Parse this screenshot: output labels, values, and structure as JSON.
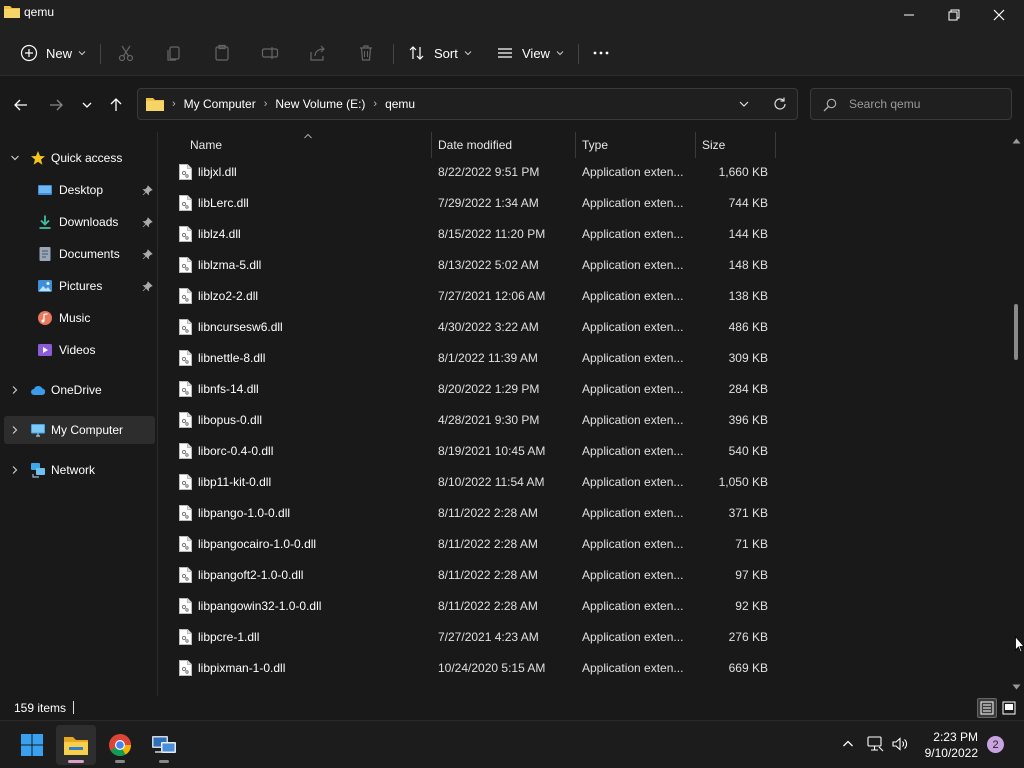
{
  "window": {
    "title": "qemu"
  },
  "toolbar": {
    "new_label": "New",
    "sort_label": "Sort",
    "view_label": "View"
  },
  "address": {
    "crumbs": [
      "My Computer",
      "New Volume (E:)",
      "qemu"
    ],
    "search_placeholder": "Search qemu"
  },
  "sidebar": {
    "quick_access": "Quick access",
    "pinned": [
      "Desktop",
      "Downloads",
      "Documents",
      "Pictures"
    ],
    "music": "Music",
    "videos": "Videos",
    "onedrive": "OneDrive",
    "my_computer": "My Computer",
    "network": "Network"
  },
  "columns": {
    "name": "Name",
    "date": "Date modified",
    "type": "Type",
    "size": "Size"
  },
  "files": [
    {
      "name": "libjxl.dll",
      "date": "8/22/2022 9:51 PM",
      "type": "Application exten...",
      "size": "1,660 KB"
    },
    {
      "name": "libLerc.dll",
      "date": "7/29/2022 1:34 AM",
      "type": "Application exten...",
      "size": "744 KB"
    },
    {
      "name": "liblz4.dll",
      "date": "8/15/2022 11:20 PM",
      "type": "Application exten...",
      "size": "144 KB"
    },
    {
      "name": "liblzma-5.dll",
      "date": "8/13/2022 5:02 AM",
      "type": "Application exten...",
      "size": "148 KB"
    },
    {
      "name": "liblzo2-2.dll",
      "date": "7/27/2021 12:06 AM",
      "type": "Application exten...",
      "size": "138 KB"
    },
    {
      "name": "libncursesw6.dll",
      "date": "4/30/2022 3:22 AM",
      "type": "Application exten...",
      "size": "486 KB"
    },
    {
      "name": "libnettle-8.dll",
      "date": "8/1/2022 11:39 AM",
      "type": "Application exten...",
      "size": "309 KB"
    },
    {
      "name": "libnfs-14.dll",
      "date": "8/20/2022 1:29 PM",
      "type": "Application exten...",
      "size": "284 KB"
    },
    {
      "name": "libopus-0.dll",
      "date": "4/28/2021 9:30 PM",
      "type": "Application exten...",
      "size": "396 KB"
    },
    {
      "name": "liborc-0.4-0.dll",
      "date": "8/19/2021 10:45 AM",
      "type": "Application exten...",
      "size": "540 KB"
    },
    {
      "name": "libp11-kit-0.dll",
      "date": "8/10/2022 11:54 AM",
      "type": "Application exten...",
      "size": "1,050 KB"
    },
    {
      "name": "libpango-1.0-0.dll",
      "date": "8/11/2022 2:28 AM",
      "type": "Application exten...",
      "size": "371 KB"
    },
    {
      "name": "libpangocairo-1.0-0.dll",
      "date": "8/11/2022 2:28 AM",
      "type": "Application exten...",
      "size": "71 KB"
    },
    {
      "name": "libpangoft2-1.0-0.dll",
      "date": "8/11/2022 2:28 AM",
      "type": "Application exten...",
      "size": "97 KB"
    },
    {
      "name": "libpangowin32-1.0-0.dll",
      "date": "8/11/2022 2:28 AM",
      "type": "Application exten...",
      "size": "92 KB"
    },
    {
      "name": "libpcre-1.dll",
      "date": "7/27/2021 4:23 AM",
      "type": "Application exten...",
      "size": "276 KB"
    },
    {
      "name": "libpixman-1-0.dll",
      "date": "10/24/2020 5:15 AM",
      "type": "Application exten...",
      "size": "669 KB"
    }
  ],
  "status": {
    "item_count": "159 items"
  },
  "taskbar": {
    "time": "2:23 PM",
    "date": "9/10/2022",
    "notification_count": "2"
  },
  "colors": {
    "folder": "#f0c040",
    "accent": "#60cdff",
    "star": "#f5c518"
  }
}
